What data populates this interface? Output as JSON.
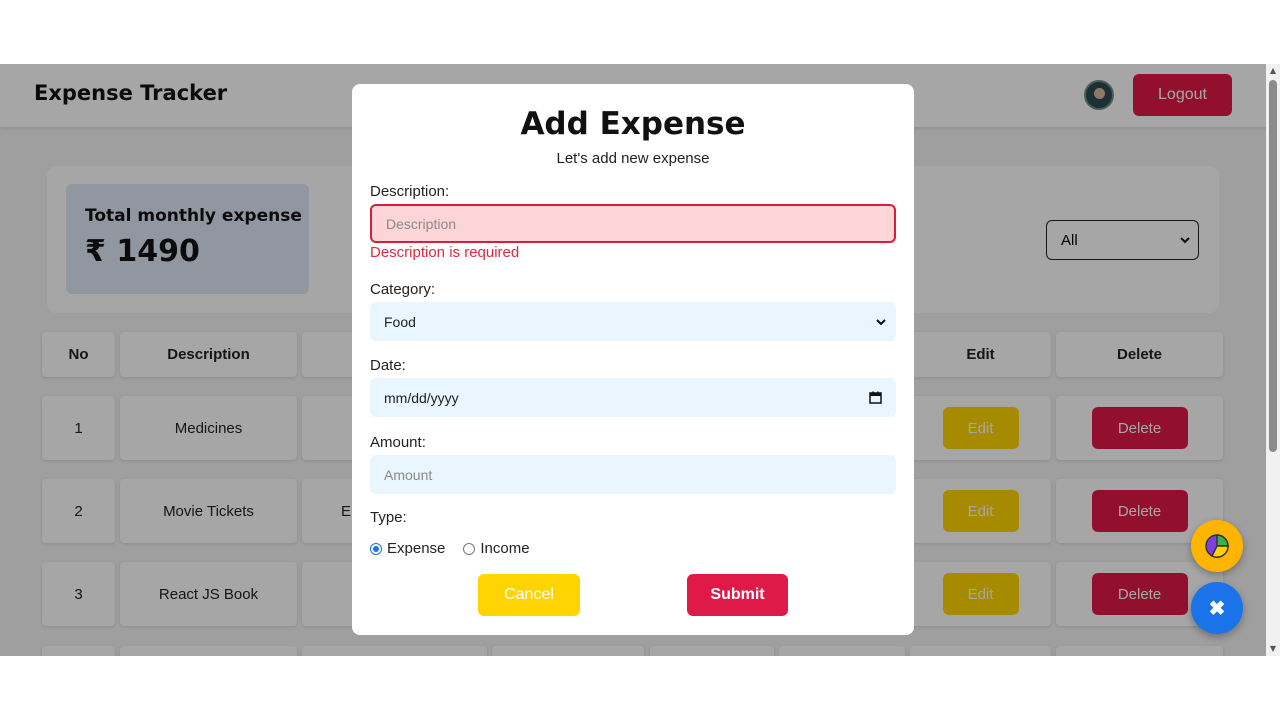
{
  "navbar": {
    "title": "Expense Tracker",
    "logout_label": "Logout"
  },
  "summary": {
    "total_label": "Total monthly expense",
    "total_value": "₹ 1490",
    "filter_value": "All"
  },
  "table": {
    "headers": {
      "no": "No",
      "description": "Description",
      "edit": "Edit",
      "delete": "Delete"
    },
    "rows": [
      {
        "no": "1",
        "description": "Medicines",
        "category_partial": "",
        "edit": "Edit",
        "delete": "Delete"
      },
      {
        "no": "2",
        "description": "Movie Tickets",
        "category_partial": "Er",
        "edit": "Edit",
        "delete": "Delete"
      },
      {
        "no": "3",
        "description": "React JS Book",
        "category_partial": "",
        "edit": "Edit",
        "delete": "Delete"
      }
    ]
  },
  "modal": {
    "title": "Add Expense",
    "subtitle": "Let's add new expense",
    "description_label": "Description:",
    "description_placeholder": "Description",
    "description_error": "Description is required",
    "category_label": "Category:",
    "category_value": "Food",
    "date_label": "Date:",
    "date_placeholder": "mm/dd/yyyy",
    "amount_label": "Amount:",
    "amount_placeholder": "Amount",
    "type_label": "Type:",
    "type_options": [
      "Expense",
      "Income"
    ],
    "type_selected": "Expense",
    "cancel_label": "Cancel",
    "submit_label": "Submit"
  },
  "fabs": {
    "close_symbol": "✖"
  },
  "colors": {
    "primary_red": "#e01a48",
    "yellow": "#ffd400",
    "blue": "#1a73e8",
    "error_red": "#e0293d",
    "field_bg": "#e9f5ff"
  },
  "icons": [
    "chevron-down-icon",
    "calendar-icon",
    "pie-chart-icon",
    "close-icon"
  ]
}
